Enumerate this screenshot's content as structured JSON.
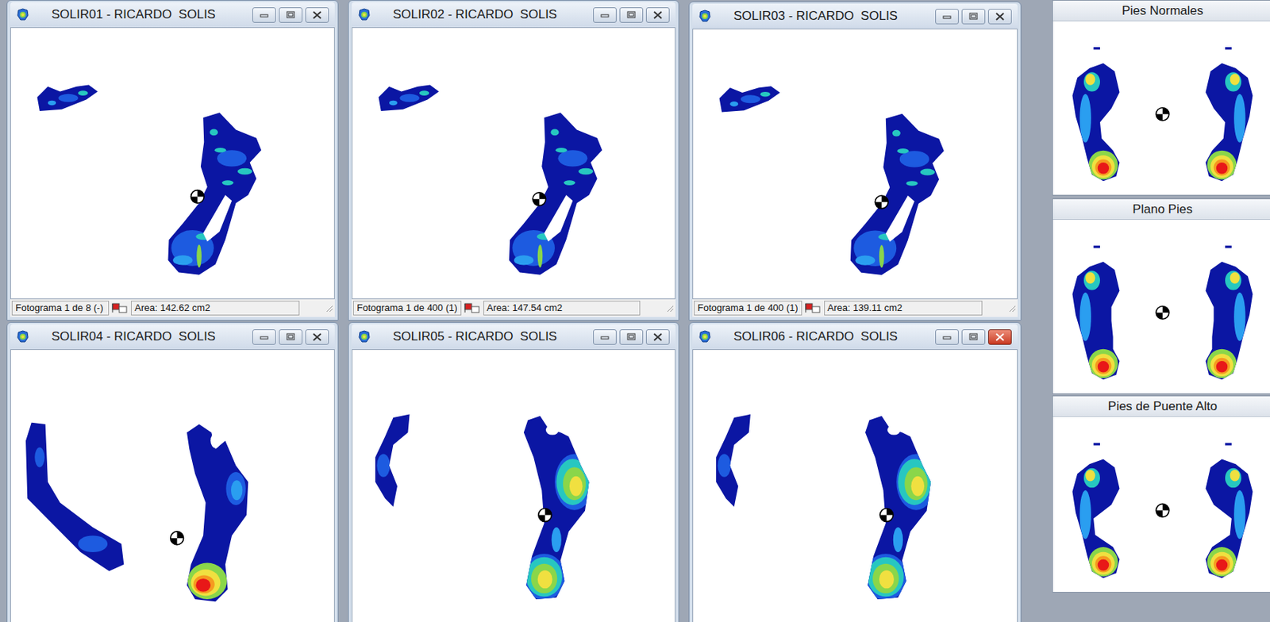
{
  "windows": [
    {
      "title": "SOLIR01 - RICARDO  SOLIS",
      "active": false,
      "status": {
        "frame": "Fotograma 1 de 8 (-)",
        "area": "Area: 142.62 cm2"
      }
    },
    {
      "title": "SOLIR02 - RICARDO  SOLIS",
      "active": false,
      "status": {
        "frame": "Fotograma 1 de 400 (1)",
        "area": "Area: 147.54 cm2"
      }
    },
    {
      "title": "SOLIR03 - RICARDO  SOLIS",
      "active": false,
      "status": {
        "frame": "Fotograma 1 de 400 (1)",
        "area": "Area: 139.11 cm2"
      }
    },
    {
      "title": "SOLIR04 - RICARDO  SOLIS",
      "active": false
    },
    {
      "title": "SOLIR05 - RICARDO  SOLIS",
      "active": false
    },
    {
      "title": "SOLIR06 - RICARDO  SOLIS",
      "active": true
    }
  ],
  "reference_panels": [
    {
      "title": "Pies Normales"
    },
    {
      "title": "Plano Pies"
    },
    {
      "title": "Pies de Puente Alto"
    }
  ]
}
